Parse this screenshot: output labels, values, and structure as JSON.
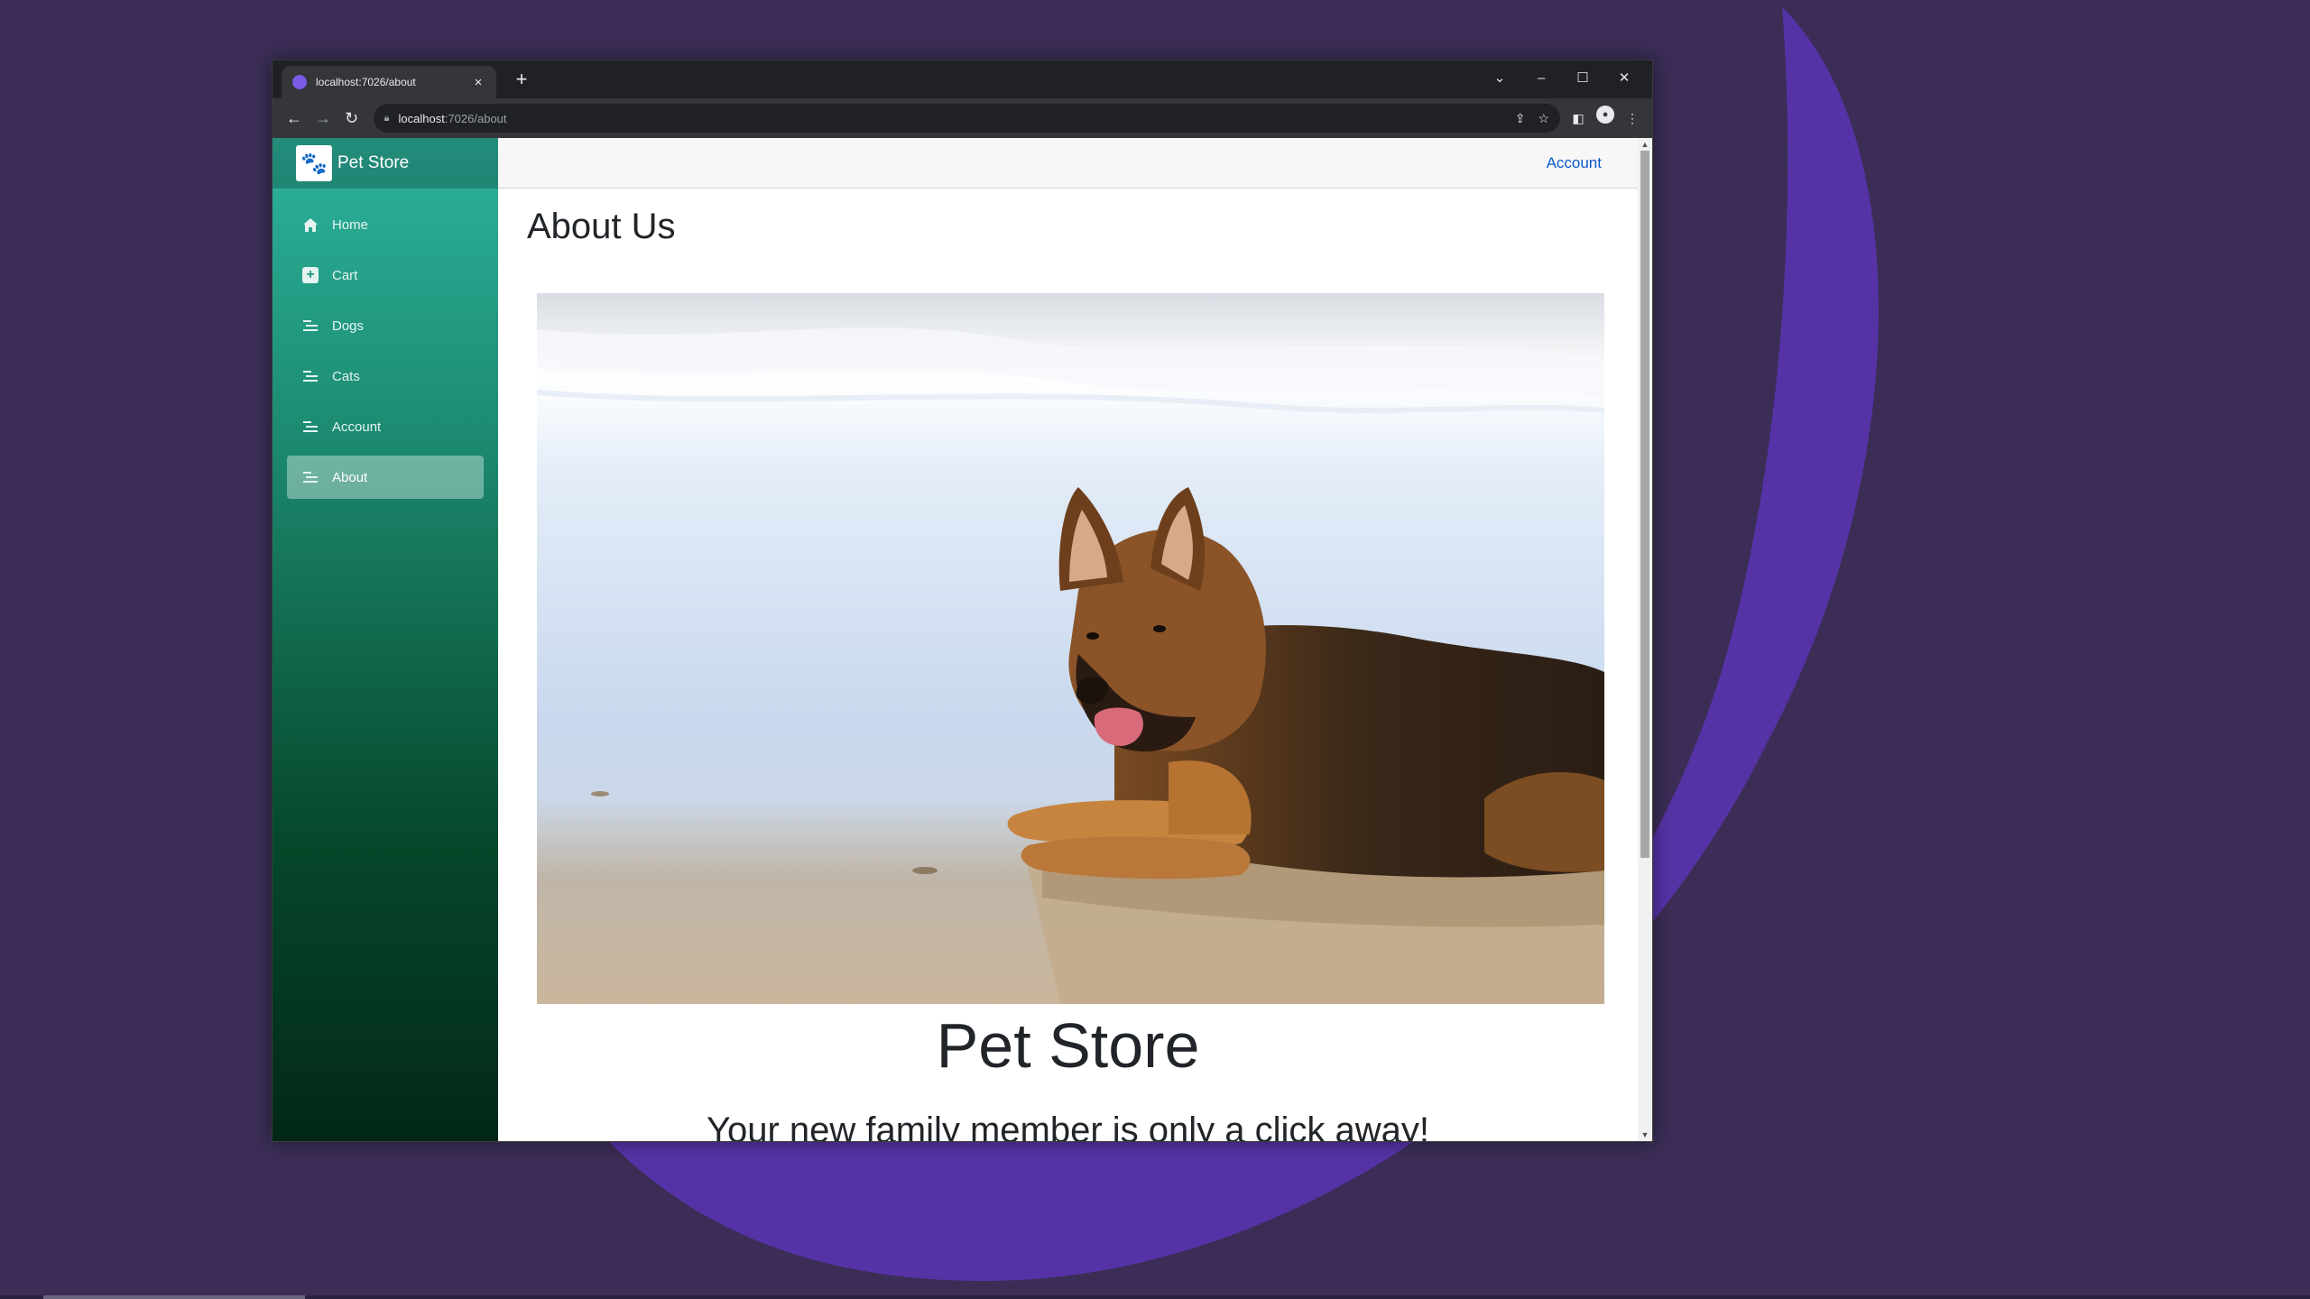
{
  "browser": {
    "tab_title": "localhost:7026/about",
    "tab_close": "×",
    "new_tab": "+",
    "window_controls": {
      "chevron": "⌄",
      "minimize": "–",
      "maximize": "☐",
      "close": "✕"
    },
    "back": "←",
    "forward": "→",
    "reload": "↻",
    "url_host": "localhost",
    "url_path": ":7026/about",
    "share_icon": "⇪",
    "star_icon": "☆",
    "sidepanel_icon": "◧",
    "profile_icon": "●",
    "menu_icon": "⋮"
  },
  "sidebar": {
    "brand_logo": "🐾",
    "brand_name": "Pet Store",
    "items": [
      {
        "label": "Home",
        "icon": "home-icon",
        "active": false
      },
      {
        "label": "Cart",
        "icon": "plus-square-icon",
        "active": false
      },
      {
        "label": "Dogs",
        "icon": "list-icon",
        "active": false
      },
      {
        "label": "Cats",
        "icon": "list-icon",
        "active": false
      },
      {
        "label": "Account",
        "icon": "list-icon",
        "active": false
      },
      {
        "label": "About",
        "icon": "list-icon",
        "active": true
      }
    ]
  },
  "topbar": {
    "account_link": "Account"
  },
  "main": {
    "page_title": "About Us",
    "hero_image": "german-shepherd-puppy-on-beach",
    "store_title": "Pet Store",
    "tagline": "Your new family member is only a click away!"
  },
  "colors": {
    "desktop": "#3b2d56",
    "swoosh": "#5533a6",
    "sidebar_top": "#2db39d",
    "sidebar_bottom": "#032818",
    "link": "#0a58ca"
  }
}
